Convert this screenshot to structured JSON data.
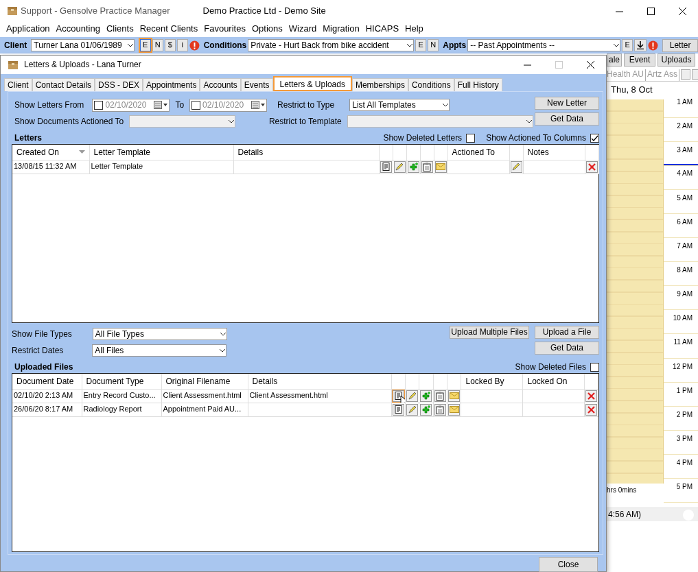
{
  "window": {
    "title": "Support - Gensolve Practice Manager",
    "practice": "Demo Practice Ltd - Demo Site"
  },
  "menu": [
    "Application",
    "Accounting",
    "Clients",
    "Recent Clients",
    "Favourites",
    "Options",
    "Wizard",
    "Migration",
    "HICAPS",
    "Help"
  ],
  "toolbar": {
    "client_label": "Client",
    "client": "Turner Lana 01/06/1989",
    "client_buttons": [
      {
        "label": "E",
        "selected": true
      },
      {
        "label": "N",
        "selected": false
      },
      {
        "label": "$",
        "selected": false
      },
      {
        "label": "i",
        "selected": false
      }
    ],
    "conditions_label": "Conditions",
    "condition": "Private - Hurt Back from bike accident",
    "condition_buttons": [
      "E",
      "N"
    ],
    "appts_label": "Appts",
    "appointment": "-- Past Appointments --",
    "appointment_buttons": [
      "E"
    ],
    "letter_button": "Letter"
  },
  "schedule": {
    "buttons": [
      "ale",
      "Event",
      "Uploads"
    ],
    "practitioner_tabs": [
      "Health AU",
      "Artz Ass"
    ],
    "date": "Thu, 8 Oct",
    "times": [
      "1 AM",
      "2 AM",
      "3 AM",
      "4 AM",
      "5 AM",
      "6 AM",
      "7 AM",
      "8 AM",
      "9 AM",
      "10 AM",
      "11 AM",
      "12 PM",
      "1 PM",
      "2 PM",
      "3 PM",
      "4 PM",
      "5 PM"
    ],
    "duration": "hrs 0mins",
    "status": "4:56 AM)"
  },
  "dialog": {
    "title": "Letters & Uploads - Lana Turner",
    "tabs": [
      {
        "label": "Client",
        "selected": false
      },
      {
        "label": "Contact Details",
        "selected": false
      },
      {
        "label": "DSS - DEX",
        "selected": false
      },
      {
        "label": "Appointments",
        "selected": false
      },
      {
        "label": "Accounts",
        "selected": false
      },
      {
        "label": "Events",
        "selected": false
      },
      {
        "label": "Letters & Uploads",
        "selected": true
      },
      {
        "label": "Memberships",
        "selected": false
      },
      {
        "label": "Conditions",
        "selected": false
      },
      {
        "label": "Full History",
        "selected": false
      }
    ],
    "letter_filters": {
      "from_label": "Show Letters From",
      "from": {
        "checked": false,
        "value": "02/10/2020"
      },
      "to_label": "To",
      "to": {
        "checked": false,
        "value": "02/10/2020"
      },
      "actioned_to_label": "Show Documents Actioned To",
      "type_label": "Restrict to Type",
      "type": "List All Templates",
      "template_label": "Restrict to Template"
    },
    "letter_buttons": [
      "New Letter",
      "Get Data"
    ],
    "letters": {
      "title": "Letters",
      "options": [
        {
          "label": "Show Deleted Letters",
          "checked": false
        },
        {
          "label": "Show Actioned To Columns",
          "checked": true
        }
      ],
      "columns": [
        "Created On",
        "Letter Template",
        "Details",
        "Actioned To",
        "Notes"
      ],
      "rows": [
        {
          "created_on": "13/08/15 11:32 AM",
          "letter_template": "Letter Template"
        }
      ]
    },
    "file_filters": {
      "types_label": "Show File Types",
      "types": "All File Types",
      "dates_label": "Restrict Dates",
      "dates": "All Files"
    },
    "file_buttons": [
      "Upload Multiple Files",
      "Upload a File",
      "Get Data"
    ],
    "uploads": {
      "title": "Uploaded Files",
      "options": [
        {
          "label": "Show Deleted Files",
          "checked": false
        }
      ],
      "columns": [
        "Document Date",
        "Document Type",
        "Original Filename",
        "Details",
        "Locked By",
        "Locked On"
      ],
      "rows": [
        {
          "document_date": "02/10/20 2:13 AM",
          "document_type": "Entry Record Custo...",
          "original_filename": "Client Assessment.html",
          "details": "Client Assessment.html",
          "highlighted": true
        },
        {
          "document_date": "26/06/20 8:17 AM",
          "document_type": "Radiology Report",
          "original_filename": "Appointment Paid AU...",
          "highlighted": false
        }
      ]
    },
    "close_button": "Close"
  }
}
